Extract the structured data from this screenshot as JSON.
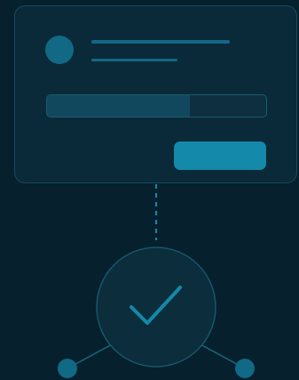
{
  "progress": 0.65,
  "colors": {
    "background": "#06202d",
    "card": "#0a2a39",
    "accent": "#1489a9",
    "muted_line": "#126985",
    "progress_fill": "#12485d"
  },
  "icons": {
    "status": "checkmark-icon",
    "user": "avatar-icon",
    "node": "node-dot-icon"
  }
}
